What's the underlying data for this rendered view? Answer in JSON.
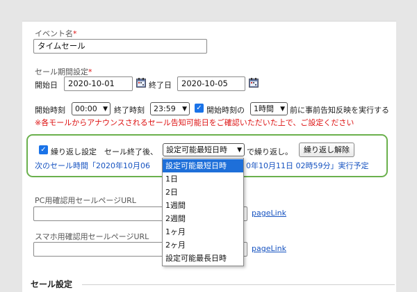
{
  "event_name": {
    "label": "イベント名",
    "required_mark": "*",
    "value": "タイムセール"
  },
  "sale_period": {
    "label": "セール期間設定",
    "required_mark": "*",
    "start_date_label": "開始日",
    "start_date_value": "2020-10-01",
    "end_date_label": "終了日",
    "end_date_value": "2020-10-05",
    "calendar_icon": "calendar-icon"
  },
  "time_settings": {
    "start_time_label": "開始時刻",
    "start_time_value": "00:00",
    "end_time_label": "終了時刻",
    "end_time_value": "23:59",
    "prenotify_checkbox_label": "開始時刻の",
    "prenotify_select_value": "1時間",
    "prenotify_suffix": "前に事前告知反映を実行する",
    "notice": "※各モールからアナウンスされるセール告知可能日をご確認いただいた上で、ご設定ください"
  },
  "repeat": {
    "checkbox_label": "繰り返し設定",
    "after_end_label": "セール終了後、",
    "select_value": "設定可能最短日時",
    "repeat_suffix": "で繰り返し。",
    "cancel_button": "繰り返し解除",
    "next_prefix": "次のセール時間「2020年10月06",
    "next_suffix": "0年10月11日 02時59分」実行予定",
    "options": [
      "設定可能最短日時",
      "1日",
      "2日",
      "1週間",
      "2週間",
      "1ヶ月",
      "2ヶ月",
      "設定可能最長日時"
    ],
    "selected_index": 0
  },
  "pc_url": {
    "label": "PC用確認用セールページURL",
    "value": "",
    "link": "pageLink"
  },
  "sp_url": {
    "label": "スマホ用確認用セールページURL",
    "value": "",
    "link": "pageLink"
  },
  "sale_settings": {
    "title": "セール設定"
  },
  "colors": {
    "accent_green": "#6ab04c",
    "link_blue": "#1552c0",
    "selected_blue": "#1e6fd9",
    "required_red": "#dd1111"
  }
}
